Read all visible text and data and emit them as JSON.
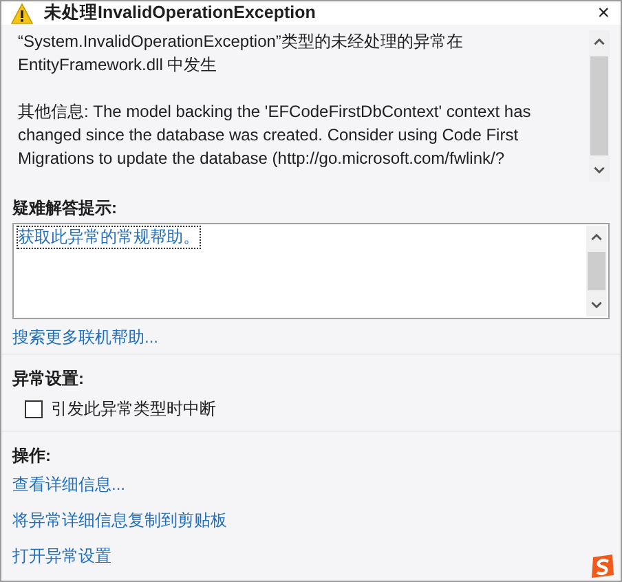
{
  "window": {
    "title": "未处理InvalidOperationException",
    "close": "×"
  },
  "message": {
    "paragraphs": [
      "“System.InvalidOperationException”类型的未经处理的异常在 EntityFramework.dll 中发生",
      "其他信息: The model backing the 'EFCodeFirstDbContext' context has changed since the database was created. Consider using Code First Migrations to update the database (http://go.microsoft.com/fwlink/?"
    ]
  },
  "troubleshooting": {
    "heading": "疑难解答提示:",
    "tips": [
      {
        "label": "获取此异常的常规帮助。",
        "selected": true
      }
    ],
    "more_link": "搜索更多联机帮助..."
  },
  "exception_settings": {
    "heading": "异常设置:",
    "options": [
      {
        "label": "引发此异常类型时中断",
        "checked": false
      }
    ]
  },
  "actions": {
    "heading": "操作:",
    "links": [
      "查看详细信息...",
      "将异常详细信息复制到剪贴板",
      "打开异常设置"
    ]
  }
}
